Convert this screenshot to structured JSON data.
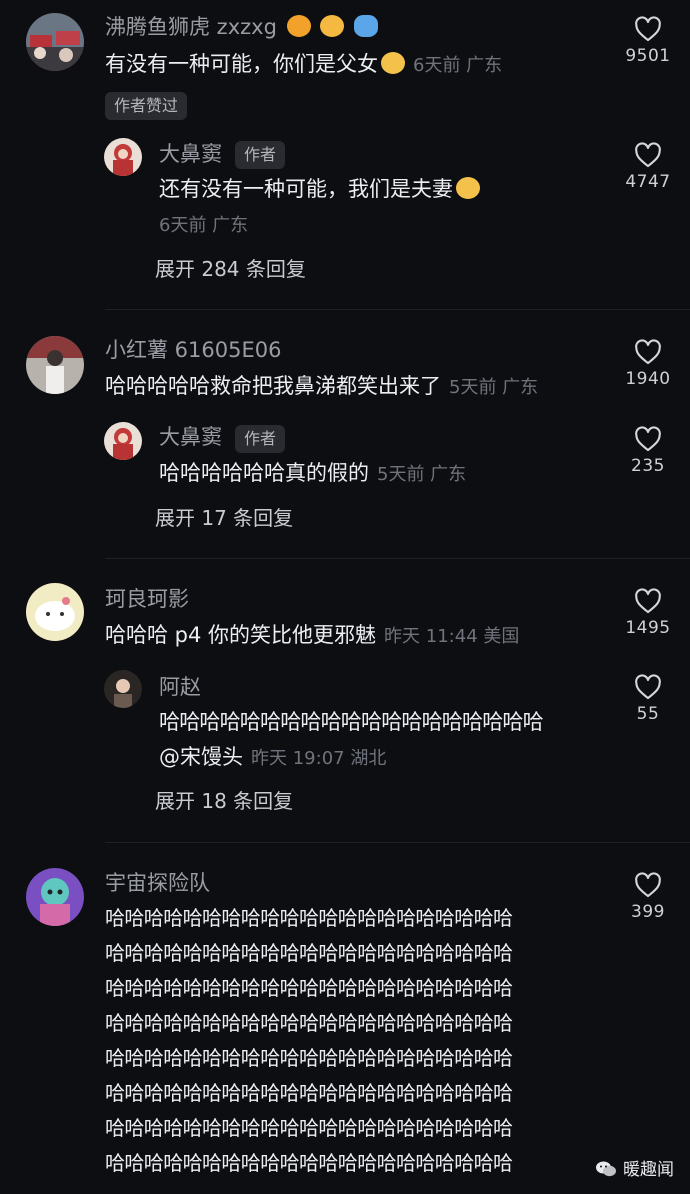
{
  "comments": [
    {
      "user": "沸腾鱼狮虎 zxzxg",
      "text": "有没有一种可能，你们是父女",
      "meta": "6天前 广东",
      "likes": "9501",
      "badge": "作者赞过",
      "reply": {
        "user": "大鼻窦",
        "tag": "作者",
        "text": "还有没有一种可能，我们是夫妻",
        "meta": "6天前 广东",
        "likes": "4747"
      },
      "expand": "展开 284 条回复"
    },
    {
      "user": "小红薯 61605E06",
      "text": "哈哈哈哈哈救命把我鼻涕都笑出来了",
      "meta": "5天前 广东",
      "likes": "1940",
      "reply": {
        "user": "大鼻窦",
        "tag": "作者",
        "text": "哈哈哈哈哈哈真的假的",
        "meta": "5天前 广东",
        "likes": "235"
      },
      "expand": "展开 17 条回复"
    },
    {
      "user": "珂良珂影",
      "text": "哈哈哈 p4 你的笑比他更邪魅",
      "meta": "昨天 11:44 美国",
      "likes": "1495",
      "reply": {
        "user": "阿赵",
        "text": "哈哈哈哈哈哈哈哈哈哈哈哈哈哈哈哈哈哈哈",
        "mention": "@宋馒头",
        "meta": "昨天 19:07 湖北",
        "likes": "55"
      },
      "expand": "展开 18 条回复"
    },
    {
      "user": "宇宙探险队",
      "lines": [
        "哈哈哈哈哈哈哈哈哈哈哈哈哈哈哈哈哈哈哈哈哈",
        "哈哈哈哈哈哈哈哈哈哈哈哈哈哈哈哈哈哈哈哈哈",
        "哈哈哈哈哈哈哈哈哈哈哈哈哈哈哈哈哈哈哈哈哈",
        "哈哈哈哈哈哈哈哈哈哈哈哈哈哈哈哈哈哈哈哈哈",
        "哈哈哈哈哈哈哈哈哈哈哈哈哈哈哈哈哈哈哈哈哈",
        "哈哈哈哈哈哈哈哈哈哈哈哈哈哈哈哈哈哈哈哈哈",
        "哈哈哈哈哈哈哈哈哈哈哈哈哈哈哈哈哈哈哈哈哈",
        "哈哈哈哈哈哈哈哈哈哈哈哈哈哈哈哈哈哈哈哈哈"
      ],
      "likes": "399"
    }
  ],
  "watermark": "暖趣闻",
  "icons": {
    "like": "heart-outline-icon",
    "emoji": "grinning-emoji-icon",
    "user_emojis": [
      "lion-emoji-icon",
      "tiger-emoji-icon",
      "fish-emoji-icon"
    ]
  },
  "colors": {
    "background": "#0d0e12",
    "text": "#eceef2",
    "muted": "#70737b",
    "badge_bg": "#2a2b31"
  }
}
